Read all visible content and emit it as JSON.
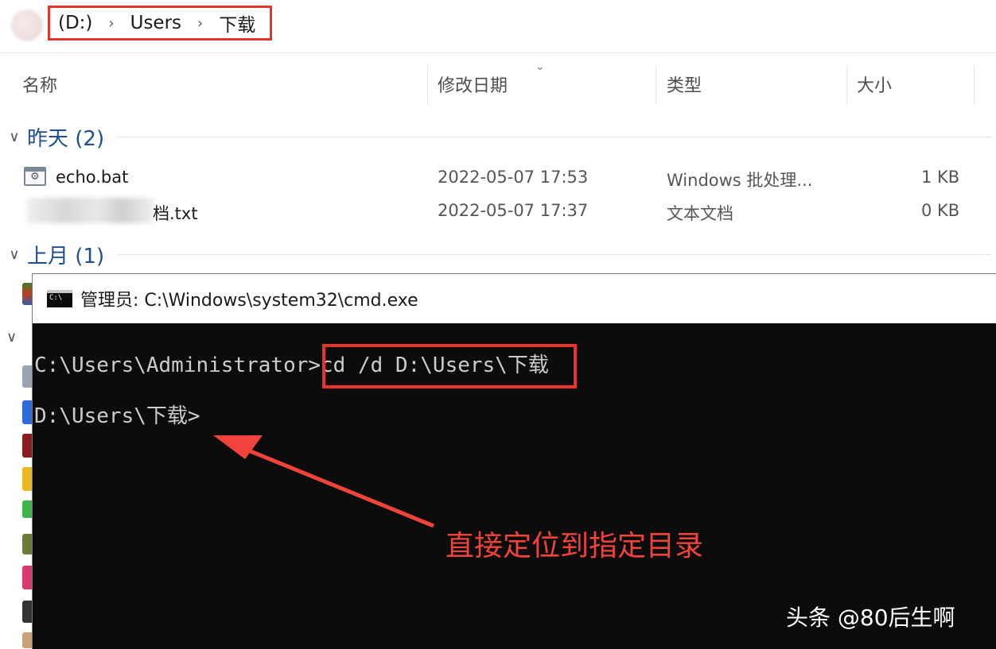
{
  "address_bar": {
    "drive": "(D:)",
    "users": "Users",
    "folder": "下载"
  },
  "columns": {
    "name": "名称",
    "modified": "修改日期",
    "type": "类型",
    "size": "大小"
  },
  "groups": {
    "yesterday": "昨天 (2)",
    "last_month": "上月 (1)"
  },
  "files": [
    {
      "name": "echo.bat",
      "modified": "2022-05-07 17:53",
      "type": "Windows 批处理...",
      "size": "1 KB"
    },
    {
      "name": "档.txt",
      "modified": "2022-05-07 17:37",
      "type": "文本文档",
      "size": "0 KB"
    }
  ],
  "cmd": {
    "title": "管理员: C:\\Windows\\system32\\cmd.exe",
    "line1_prompt": "C:\\Users\\Administrator>",
    "line1_command": "cd /d D:\\Users\\下载",
    "line2_prompt": "D:\\Users\\下载>"
  },
  "annotation": "直接定位到指定目录",
  "watermark": "头条 @80后生啊",
  "colors": {
    "highlight": "#e8322c",
    "console_bg": "#0c0c0c",
    "console_text": "#cccccc",
    "group_header": "#1e4f8e"
  }
}
